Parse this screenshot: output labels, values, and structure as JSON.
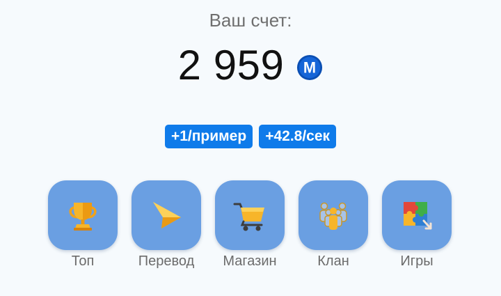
{
  "balance": {
    "label": "Ваш счет:",
    "value": "2 959",
    "currency_icon": "coin-m-icon",
    "currency_letter": "M",
    "coin_color": "#1565d8"
  },
  "rates": [
    {
      "label": "+1/пример"
    },
    {
      "label": "+42.8/сек"
    }
  ],
  "colors": {
    "accent": "#0f7bea",
    "tile": "#6a9fe2",
    "background": "#f6fafd"
  },
  "nav": [
    {
      "label": "Топ",
      "icon": "trophy-icon"
    },
    {
      "label": "Перевод",
      "icon": "send-icon"
    },
    {
      "label": "Магазин",
      "icon": "shopping-cart-icon"
    },
    {
      "label": "Клан",
      "icon": "group-icon"
    },
    {
      "label": "Игры",
      "icon": "puzzle-icon"
    }
  ]
}
